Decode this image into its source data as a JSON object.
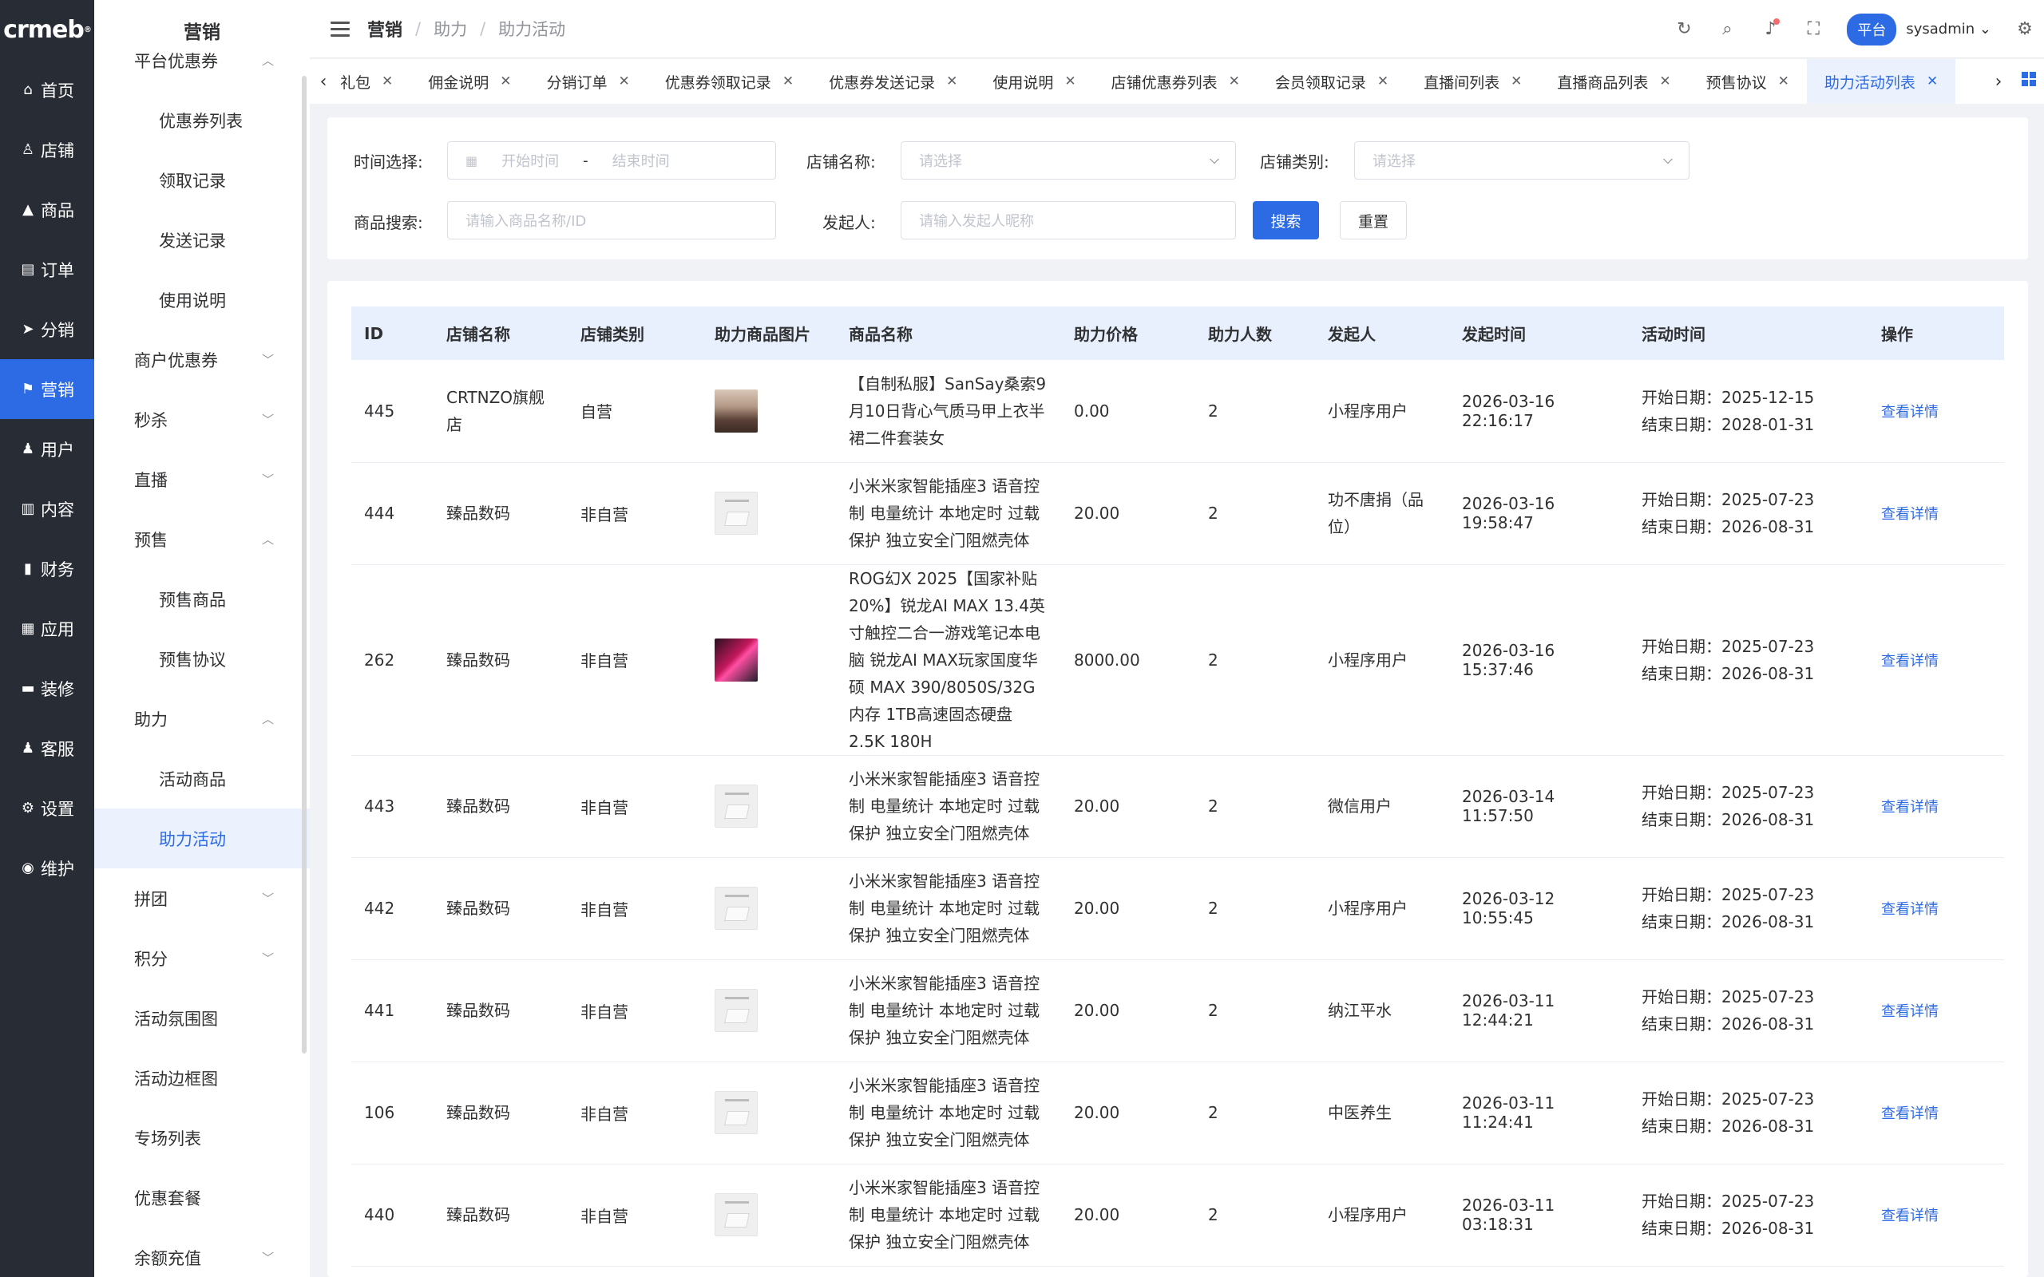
{
  "rail": {
    "logo": "crmeb",
    "items": [
      {
        "label": "首页",
        "icon": "home-icon",
        "glyph": "⌂"
      },
      {
        "label": "店铺",
        "icon": "store-icon",
        "glyph": "♙"
      },
      {
        "label": "商品",
        "icon": "bag-icon",
        "glyph": "▲"
      },
      {
        "label": "订单",
        "icon": "order-icon",
        "glyph": "▤"
      },
      {
        "label": "分销",
        "icon": "send-icon",
        "glyph": "➤"
      },
      {
        "label": "营销",
        "icon": "flag-icon",
        "glyph": "⚑"
      },
      {
        "label": "用户",
        "icon": "user-icon",
        "glyph": "♟"
      },
      {
        "label": "内容",
        "icon": "content-icon",
        "glyph": "▥"
      },
      {
        "label": "财务",
        "icon": "finance-icon",
        "glyph": "▮"
      },
      {
        "label": "应用",
        "icon": "apps-icon",
        "glyph": "▦"
      },
      {
        "label": "装修",
        "icon": "decor-icon",
        "glyph": "▬"
      },
      {
        "label": "客服",
        "icon": "service-icon",
        "glyph": "♟"
      },
      {
        "label": "设置",
        "icon": "gear-icon",
        "glyph": "⚙"
      },
      {
        "label": "维护",
        "icon": "maintain-icon",
        "glyph": "◉"
      }
    ]
  },
  "sidebar": {
    "title": "营销",
    "entries": [
      {
        "type": "group",
        "label": "平台优惠券",
        "open": true
      },
      {
        "type": "sub",
        "label": "优惠券列表"
      },
      {
        "type": "sub",
        "label": "领取记录"
      },
      {
        "type": "sub",
        "label": "发送记录"
      },
      {
        "type": "sub",
        "label": "使用说明"
      },
      {
        "type": "group",
        "label": "商户优惠券",
        "open": false
      },
      {
        "type": "group",
        "label": "秒杀",
        "open": false
      },
      {
        "type": "group",
        "label": "直播",
        "open": false
      },
      {
        "type": "group",
        "label": "预售",
        "open": true
      },
      {
        "type": "sub",
        "label": "预售商品"
      },
      {
        "type": "sub",
        "label": "预售协议"
      },
      {
        "type": "group",
        "label": "助力",
        "open": true
      },
      {
        "type": "sub",
        "label": "活动商品"
      },
      {
        "type": "sub",
        "label": "助力活动",
        "active": true
      },
      {
        "type": "group",
        "label": "拼团",
        "open": false
      },
      {
        "type": "group",
        "label": "积分",
        "open": false
      },
      {
        "type": "plain",
        "label": "活动氛围图"
      },
      {
        "type": "plain",
        "label": "活动边框图"
      },
      {
        "type": "plain",
        "label": "专场列表"
      },
      {
        "type": "plain",
        "label": "优惠套餐"
      },
      {
        "type": "group",
        "label": "余额充值",
        "open": false
      }
    ]
  },
  "header": {
    "breadcrumb": [
      "营销",
      "助力",
      "助力活动"
    ],
    "platform_badge": "平台",
    "username": "sysadmin"
  },
  "tabs": [
    {
      "label": "礼包"
    },
    {
      "label": "佣金说明"
    },
    {
      "label": "分销订单"
    },
    {
      "label": "优惠券领取记录"
    },
    {
      "label": "优惠券发送记录"
    },
    {
      "label": "使用说明"
    },
    {
      "label": "店铺优惠券列表"
    },
    {
      "label": "会员领取记录"
    },
    {
      "label": "直播间列表"
    },
    {
      "label": "直播商品列表"
    },
    {
      "label": "预售协议"
    },
    {
      "label": "助力活动列表",
      "active": true
    }
  ],
  "filters": {
    "time_label": "时间选择:",
    "start_placeholder": "开始时间",
    "date_separator": "-",
    "end_placeholder": "结束时间",
    "store_name_label": "店铺名称:",
    "store_name_placeholder": "请选择",
    "store_type_label": "店铺类别:",
    "store_type_placeholder": "请选择",
    "product_search_label": "商品搜索:",
    "product_search_placeholder": "请输入商品名称/ID",
    "initiator_label": "发起人:",
    "initiator_placeholder": "请输入发起人昵称",
    "search_button": "搜索",
    "reset_button": "重置"
  },
  "table": {
    "columns": [
      "ID",
      "店铺名称",
      "店铺类别",
      "助力商品图片",
      "商品名称",
      "助力价格",
      "助力人数",
      "发起人",
      "发起时间",
      "活动时间",
      "操作"
    ],
    "action_label": "查看详情",
    "start_prefix": "开始日期：",
    "end_prefix": "结束日期：",
    "rows": [
      {
        "id": "445",
        "store": "CRTNZO旗舰店",
        "type": "自营",
        "image": "fashion",
        "name": "【自制私服】SanSay桑索9月10日背心气质马甲上衣半裙二件套装女",
        "price": "0.00",
        "count": "2",
        "initiator": "小程序用户",
        "created": "2026-03-16 22:16:17",
        "start": "2025-12-15",
        "end": "2028-01-31"
      },
      {
        "id": "444",
        "store": "臻品数码",
        "type": "非自营",
        "image": "product",
        "name": "小米米家智能插座3 语音控制 电量统计 本地定时 过载保护 独立安全门阻燃壳体",
        "price": "20.00",
        "count": "2",
        "initiator": "功不唐捐（品位）",
        "created": "2026-03-16 19:58:47",
        "start": "2025-07-23",
        "end": "2026-08-31"
      },
      {
        "id": "262",
        "store": "臻品数码",
        "type": "非自营",
        "image": "laptop",
        "name": "ROG幻X 2025【国家补贴20%】锐龙AI MAX 13.4英寸触控二合一游戏笔记本电脑 锐龙AI MAX玩家国度华硕 MAX 390/8050S/32G内存 1TB高速固态硬盘 2.5K 180H",
        "price": "8000.00",
        "count": "2",
        "initiator": "小程序用户",
        "created": "2026-03-16 15:37:46",
        "start": "2025-07-23",
        "end": "2026-08-31"
      },
      {
        "id": "443",
        "store": "臻品数码",
        "type": "非自营",
        "image": "product",
        "name": "小米米家智能插座3 语音控制 电量统计 本地定时 过载保护 独立安全门阻燃壳体",
        "price": "20.00",
        "count": "2",
        "initiator": "微信用户",
        "created": "2026-03-14 11:57:50",
        "start": "2025-07-23",
        "end": "2026-08-31"
      },
      {
        "id": "442",
        "store": "臻品数码",
        "type": "非自营",
        "image": "product",
        "name": "小米米家智能插座3 语音控制 电量统计 本地定时 过载保护 独立安全门阻燃壳体",
        "price": "20.00",
        "count": "2",
        "initiator": "小程序用户",
        "created": "2026-03-12 10:55:45",
        "start": "2025-07-23",
        "end": "2026-08-31"
      },
      {
        "id": "441",
        "store": "臻品数码",
        "type": "非自营",
        "image": "product",
        "name": "小米米家智能插座3 语音控制 电量统计 本地定时 过载保护 独立安全门阻燃壳体",
        "price": "20.00",
        "count": "2",
        "initiator": "纳江平水",
        "created": "2026-03-11 12:44:21",
        "start": "2025-07-23",
        "end": "2026-08-31"
      },
      {
        "id": "106",
        "store": "臻品数码",
        "type": "非自营",
        "image": "product",
        "name": "小米米家智能插座3 语音控制 电量统计 本地定时 过载保护 独立安全门阻燃壳体",
        "price": "20.00",
        "count": "2",
        "initiator": "中医养生",
        "created": "2026-03-11 11:24:41",
        "start": "2025-07-23",
        "end": "2026-08-31"
      },
      {
        "id": "440",
        "store": "臻品数码",
        "type": "非自营",
        "image": "product",
        "name": "小米米家智能插座3 语音控制 电量统计 本地定时 过载保护 独立安全门阻燃壳体",
        "price": "20.00",
        "count": "2",
        "initiator": "小程序用户",
        "created": "2026-03-11 03:18:31",
        "start": "2025-07-23",
        "end": "2026-08-31"
      }
    ]
  },
  "colors": {
    "accent": "#2d6be4",
    "rail_bg": "#282c34",
    "header_row_bg": "#e9f0fd"
  }
}
